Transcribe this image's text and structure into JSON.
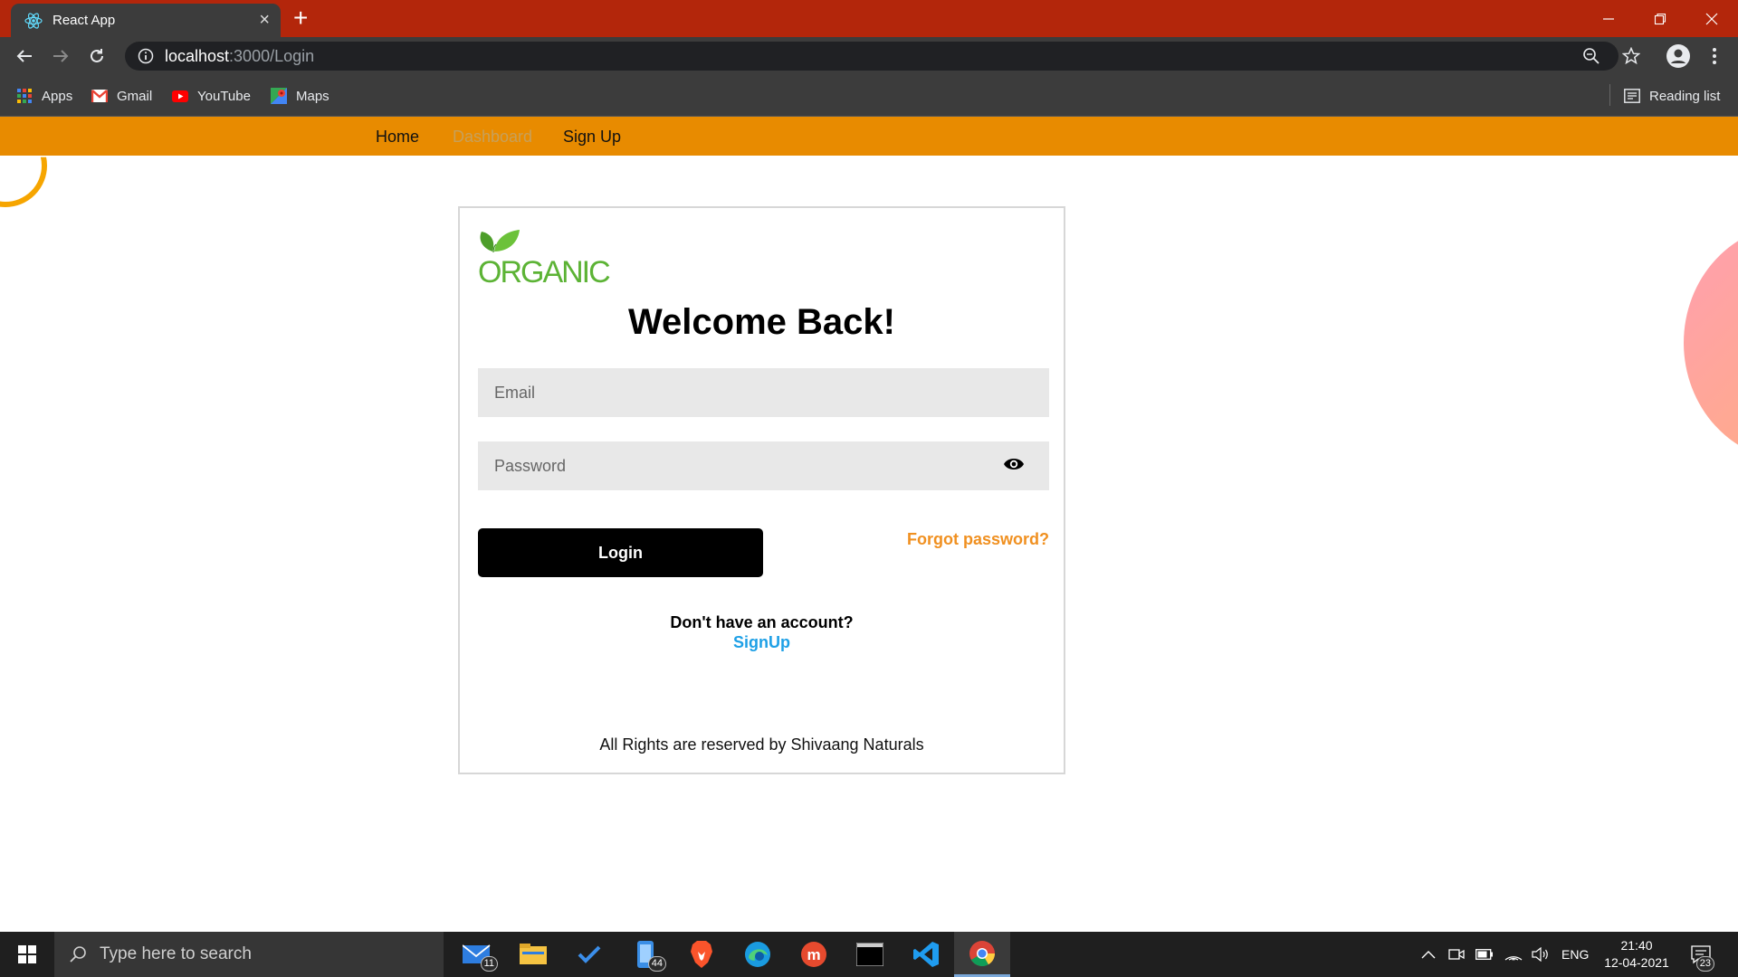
{
  "browser": {
    "tab_title": "React App",
    "url_host": "localhost",
    "url_path": ":3000/Login",
    "bookmarks": [
      "Apps",
      "Gmail",
      "YouTube",
      "Maps"
    ],
    "reading_list": "Reading list"
  },
  "nav": {
    "home": "Home",
    "dashboard": "Dashboard",
    "signup": "Sign Up"
  },
  "login": {
    "logo_text": "ORGANIC",
    "heading": "Welcome Back!",
    "email_placeholder": "Email",
    "password_placeholder": "Password",
    "login_button": "Login",
    "forgot_password": "Forgot password?",
    "no_account": "Don't have an account?",
    "signup_link": "SignUp",
    "footer": "All Rights are reserved by Shivaang Naturals"
  },
  "colors": {
    "nav_bg": "#e88b00",
    "forgot": "#f09020",
    "signup_link": "#1ea0e6",
    "logo_green": "#5cb335"
  },
  "taskbar": {
    "search_placeholder": "Type here to search",
    "mail_badge": "11",
    "phone_badge": "44",
    "language": "ENG",
    "time": "21:40",
    "date": "12-04-2021",
    "notifications": "23"
  }
}
